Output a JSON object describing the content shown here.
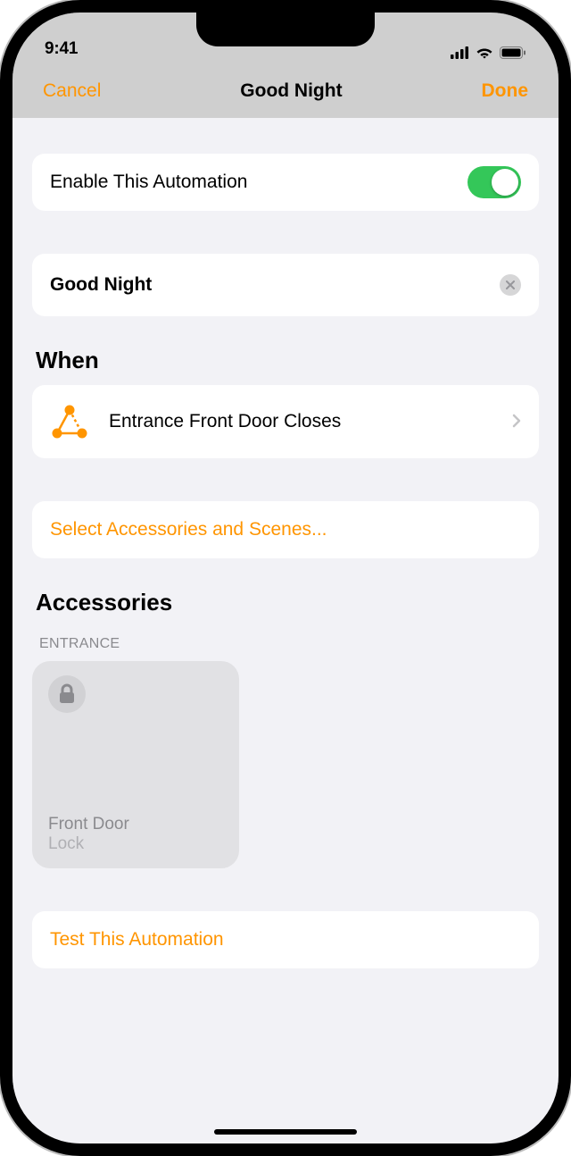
{
  "status": {
    "time": "9:41"
  },
  "nav": {
    "cancel": "Cancel",
    "title": "Good Night",
    "done": "Done"
  },
  "enable": {
    "label": "Enable This Automation",
    "on": true
  },
  "name": {
    "value": "Good Night"
  },
  "sections": {
    "when": "When",
    "accessories": "Accessories"
  },
  "trigger": {
    "label": "Entrance Front Door Closes"
  },
  "select": {
    "label": "Select Accessories and Scenes..."
  },
  "accessory_group": {
    "header": "ENTRANCE"
  },
  "tile": {
    "name": "Front Door",
    "status": "Lock"
  },
  "test": {
    "label": "Test This Automation"
  }
}
